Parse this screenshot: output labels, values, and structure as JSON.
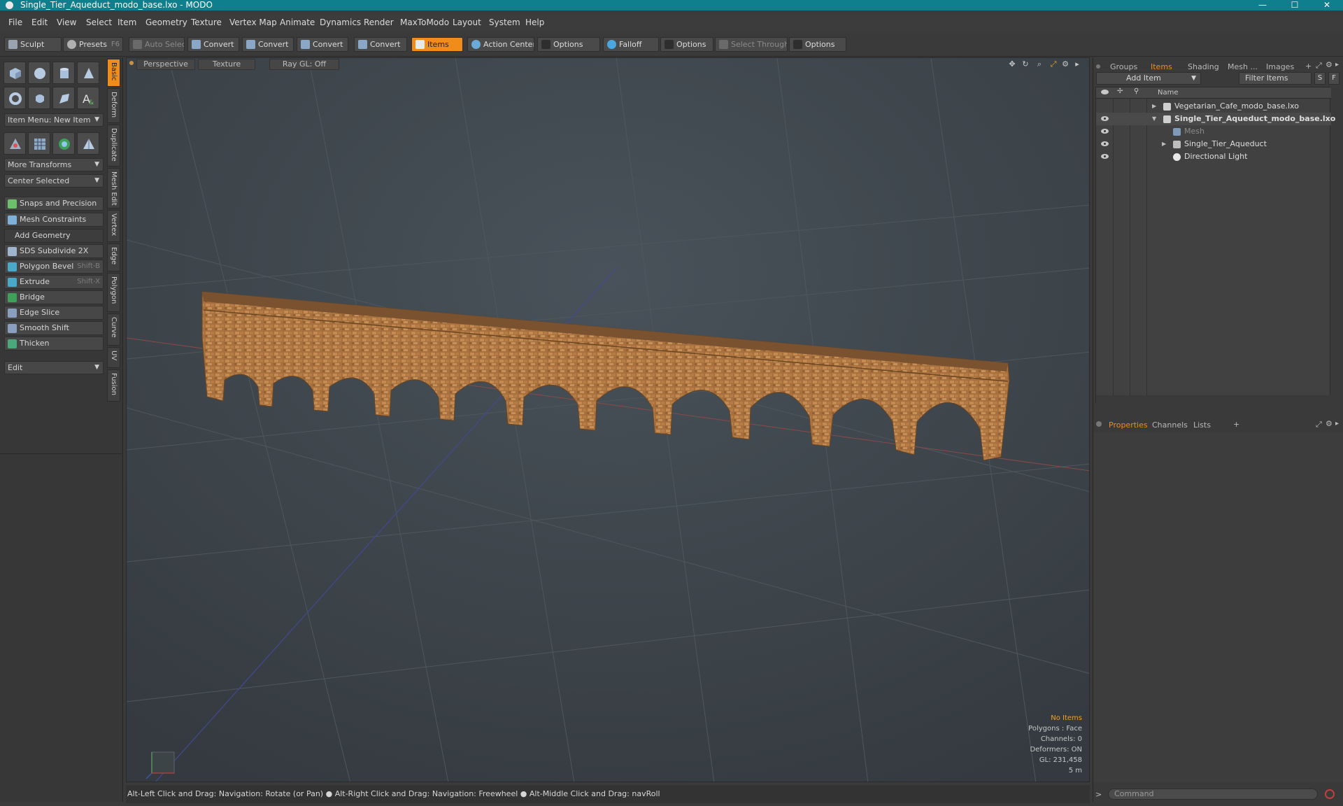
{
  "window": {
    "title": "Single_Tier_Aqueduct_modo_base.lxo - MODO",
    "minimize": "—",
    "maximize": "☐",
    "close": "✕"
  },
  "menu": [
    "File",
    "Edit",
    "View",
    "Select",
    "Item",
    "Geometry",
    "Texture",
    "Vertex Map",
    "Animate",
    "Dynamics",
    "Render",
    "MaxToModo",
    "Layout",
    "System",
    "Help"
  ],
  "toolbar": {
    "sculpt": "Sculpt",
    "presets": "Presets",
    "presets_shortcut": "F6",
    "auto_select": "Auto Select",
    "convert1": "Convert",
    "convert2": "Convert",
    "convert3": "Convert",
    "convert4": "Convert",
    "items": "Items",
    "action_center": "Action Center",
    "options1": "Options",
    "falloff": "Falloff",
    "options2": "Options",
    "select_through": "Select Through",
    "options3": "Options"
  },
  "left": {
    "item_menu": "Item Menu: New Item",
    "more_transforms": "More Transforms",
    "center_selected": "Center Selected",
    "snaps": "Snaps and Precision",
    "constraints": "Mesh Constraints",
    "add_geometry": "Add Geometry",
    "tools": [
      {
        "label": "SDS Subdivide 2X",
        "shortcut": ""
      },
      {
        "label": "Polygon Bevel",
        "shortcut": "Shift-B"
      },
      {
        "label": "Extrude",
        "shortcut": "Shift-X"
      },
      {
        "label": "Bridge",
        "shortcut": ""
      },
      {
        "label": "Edge Slice",
        "shortcut": ""
      },
      {
        "label": "Smooth Shift",
        "shortcut": ""
      },
      {
        "label": "Thicken",
        "shortcut": ""
      }
    ],
    "edit": "Edit"
  },
  "vtabs": [
    "Basic",
    "Deform",
    "Duplicate",
    "Mesh Edit",
    "Vertex",
    "Edge",
    "Polygon",
    "Curve",
    "UV",
    "Fusion"
  ],
  "viewport": {
    "view_mode": "Perspective",
    "shading": "Texture",
    "raygl": "Ray GL: Off",
    "stats": {
      "items": "No Items",
      "polygons": "Polygons : Face",
      "channels": "Channels: 0",
      "deformers": "Deformers: ON",
      "gl": "GL: 231,458",
      "scale": "5 m"
    }
  },
  "status": "Alt-Left Click and Drag: Navigation: Rotate (or Pan) ● Alt-Right Click and Drag: Navigation: Freewheel ● Alt-Middle Click and Drag: navRoll",
  "right": {
    "tabs": [
      "Groups",
      "Items",
      "Shading",
      "Mesh ...",
      "Images"
    ],
    "add_item": "Add Item",
    "filter": "Filter Items",
    "s_btn": "S",
    "f_btn": "F",
    "name_col": "Name",
    "tree": [
      {
        "label": "Vegetarian_Cafe_modo_base.lxo",
        "bold": false
      },
      {
        "label": "Single_Tier_Aqueduct_modo_base.lxo",
        "bold": true
      },
      {
        "label": "Mesh",
        "bold": false
      },
      {
        "label": "Single_Tier_Aqueduct",
        "bold": false
      },
      {
        "label": "Directional Light",
        "bold": false
      }
    ],
    "prop_tabs": [
      "Properties",
      "Channels",
      "Lists"
    ],
    "command_placeholder": "Command"
  }
}
